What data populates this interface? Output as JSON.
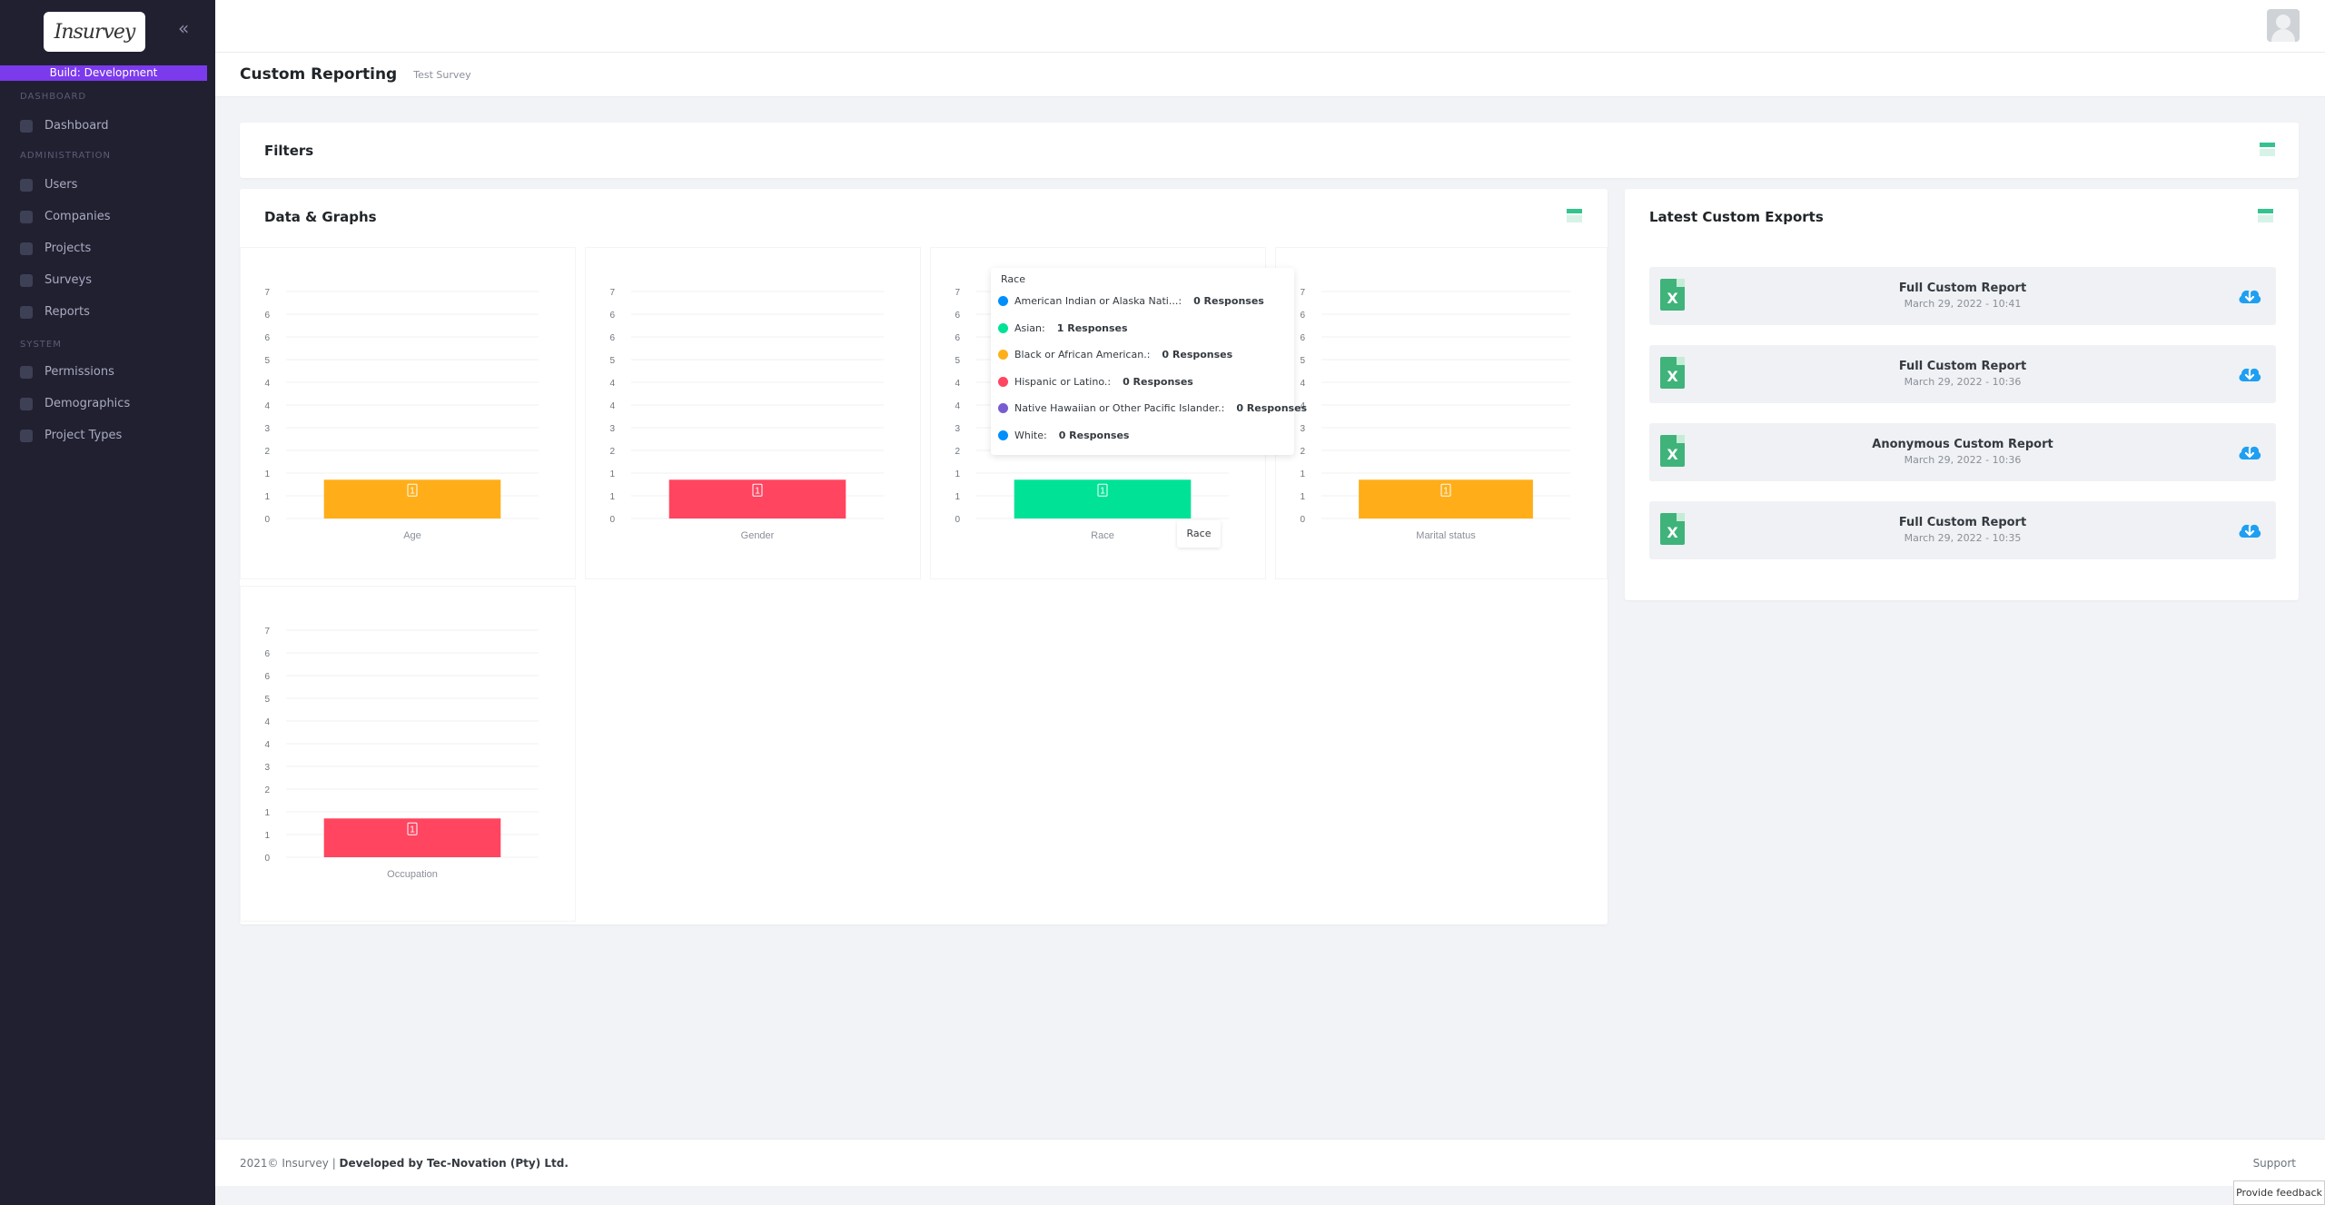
{
  "sidebar": {
    "logo": "Insurvey",
    "build": "Build: Development",
    "sections": {
      "dashboard": "DASHBOARD",
      "administration": "ADMINISTRATION",
      "system": "SYSTEM"
    },
    "items": [
      {
        "label": "Dashboard",
        "icon": "dashboard-icon"
      },
      {
        "label": "Users",
        "icon": "users-icon"
      },
      {
        "label": "Companies",
        "icon": "companies-icon"
      },
      {
        "label": "Projects",
        "icon": "projects-icon"
      },
      {
        "label": "Surveys",
        "icon": "surveys-icon"
      },
      {
        "label": "Reports",
        "icon": "reports-icon"
      },
      {
        "label": "Permissions",
        "icon": "permissions-icon"
      },
      {
        "label": "Demographics",
        "icon": "demographics-icon"
      },
      {
        "label": "Project Types",
        "icon": "project-types-icon"
      }
    ]
  },
  "header": {
    "title": "Custom Reporting",
    "subtitle": "Test Survey"
  },
  "filters": {
    "title": "Filters"
  },
  "graphs": {
    "title": "Data & Graphs"
  },
  "chart_data": [
    {
      "type": "bar",
      "categories": [
        "Age"
      ],
      "values": [
        1
      ],
      "data_labels": [
        "1"
      ],
      "yticks": [
        "0",
        "1",
        "1",
        "2",
        "3",
        "4",
        "4",
        "5",
        "6",
        "6",
        "7"
      ],
      "ylim": [
        0,
        7
      ],
      "color": "#ffae19"
    },
    {
      "type": "bar",
      "categories": [
        "Gender"
      ],
      "values": [
        1
      ],
      "data_labels": [
        "1"
      ],
      "yticks": [
        "0",
        "1",
        "1",
        "2",
        "3",
        "4",
        "4",
        "5",
        "6",
        "6",
        "7"
      ],
      "ylim": [
        0,
        7
      ],
      "color": "#ff4560"
    },
    {
      "type": "bar",
      "categories": [
        "Race"
      ],
      "values": [
        1
      ],
      "data_labels": [
        "1"
      ],
      "yticks": [
        "0",
        "1",
        "1",
        "2",
        "3",
        "4",
        "4",
        "5",
        "6",
        "6",
        "7"
      ],
      "ylim": [
        0,
        7
      ],
      "color": "#00e396"
    },
    {
      "type": "bar",
      "categories": [
        "Marital status"
      ],
      "values": [
        1
      ],
      "data_labels": [
        "1"
      ],
      "yticks": [
        "0",
        "1",
        "1",
        "2",
        "3",
        "4",
        "4",
        "5",
        "6",
        "6",
        "7"
      ],
      "ylim": [
        0,
        7
      ],
      "color": "#ffae19"
    },
    {
      "type": "bar",
      "categories": [
        "Occupation"
      ],
      "values": [
        1
      ],
      "data_labels": [
        "1"
      ],
      "yticks": [
        "0",
        "1",
        "1",
        "2",
        "3",
        "4",
        "4",
        "5",
        "6",
        "6",
        "7"
      ],
      "ylim": [
        0,
        7
      ],
      "color": "#ff4560"
    }
  ],
  "tooltip": {
    "title": "Race",
    "rows": [
      {
        "label": "American Indian or Alaska Nati...:",
        "count": "0 Responses",
        "color": "#008ffb"
      },
      {
        "label": "Asian:",
        "count": "1 Responses",
        "color": "#00e396"
      },
      {
        "label": "Black or African American.:",
        "count": "0 Responses",
        "color": "#feb019"
      },
      {
        "label": "Hispanic or Latino.:",
        "count": "0 Responses",
        "color": "#ff4560"
      },
      {
        "label": "Native Hawaiian or Other Pacific Islander.:",
        "count": "0 Responses",
        "color": "#775dd0"
      },
      {
        "label": "White:",
        "count": "0 Responses",
        "color": "#008ffb"
      }
    ],
    "hover_label": "Race"
  },
  "exports": {
    "title": "Latest Custom Exports",
    "items": [
      {
        "title": "Full Custom Report",
        "date": "March 29, 2022 - 10:41"
      },
      {
        "title": "Full Custom Report",
        "date": "March 29, 2022 - 10:36"
      },
      {
        "title": "Anonymous Custom Report",
        "date": "March 29, 2022 - 10:36"
      },
      {
        "title": "Full Custom Report",
        "date": "March 29, 2022 - 10:35"
      }
    ]
  },
  "footer": {
    "copyright": "2021© Insurvey | ",
    "developer": "Developed by Tec-Novation (Pty) Ltd.",
    "support": "Support"
  },
  "feedback": "Provide feedback"
}
